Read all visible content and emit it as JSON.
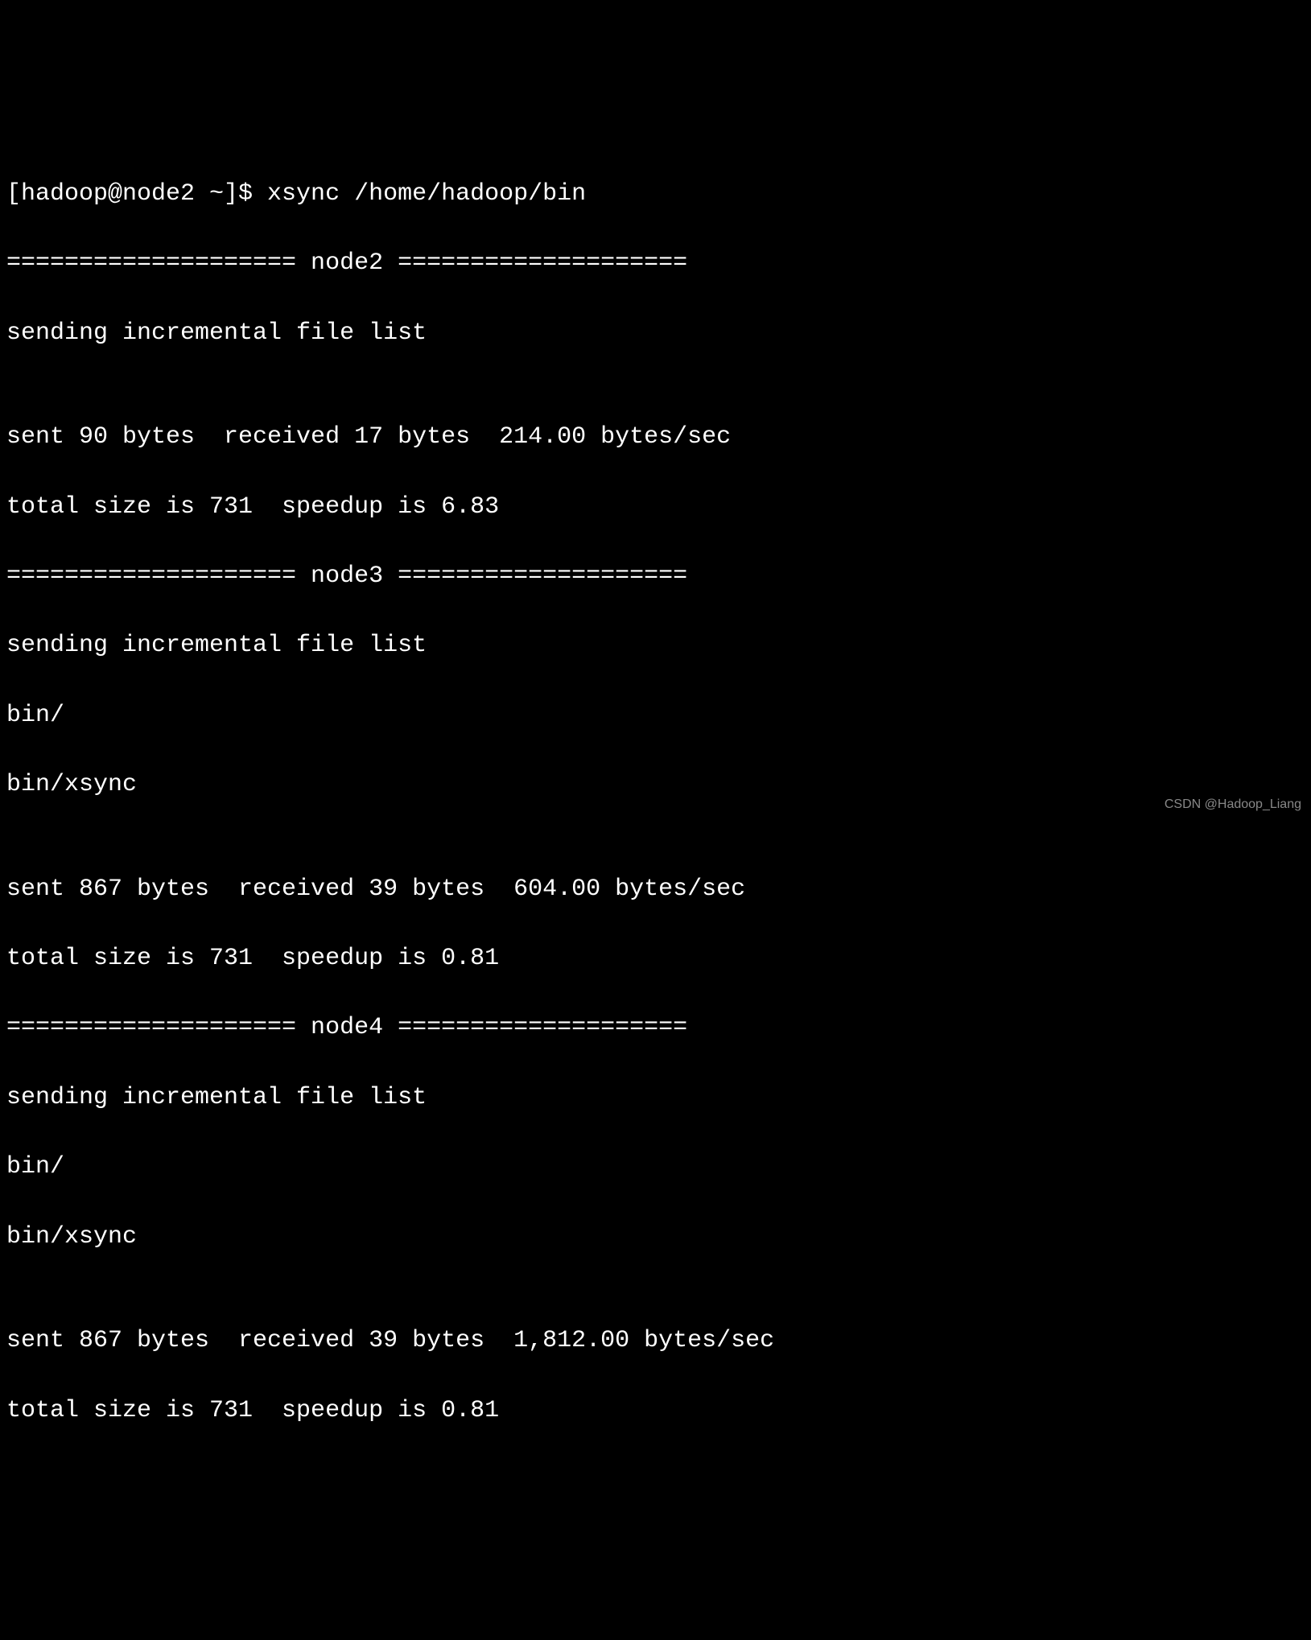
{
  "terminal": {
    "lines": [
      "[hadoop@node2 ~]$ xsync /home/hadoop/bin",
      "==================== node2 ====================",
      "sending incremental file list",
      "",
      "sent 90 bytes  received 17 bytes  214.00 bytes/sec",
      "total size is 731  speedup is 6.83",
      "==================== node3 ====================",
      "sending incremental file list",
      "bin/",
      "bin/xsync",
      "",
      "sent 867 bytes  received 39 bytes  604.00 bytes/sec",
      "total size is 731  speedup is 0.81",
      "==================== node4 ====================",
      "sending incremental file list",
      "bin/",
      "bin/xsync",
      "",
      "sent 867 bytes  received 39 bytes  1,812.00 bytes/sec",
      "total size is 731  speedup is 0.81"
    ]
  },
  "watermark": "CSDN @Hadoop_Liang"
}
